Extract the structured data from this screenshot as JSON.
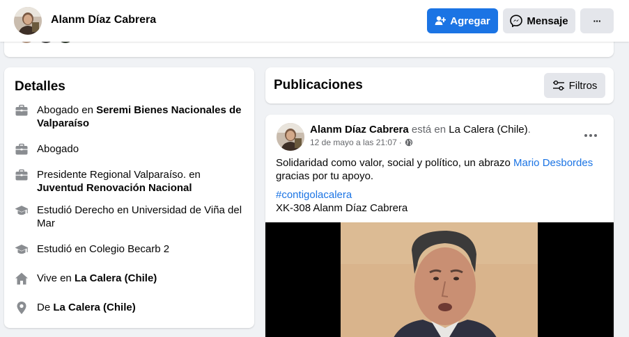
{
  "header": {
    "profile_name": "Alanm Díaz Cabrera",
    "add_label": "Agregar",
    "message_label": "Mensaje",
    "more_label": "···"
  },
  "details": {
    "title": "Detalles",
    "items": [
      {
        "icon": "briefcase-icon",
        "pre": "Abogado en ",
        "strong": "Seremi Bienes Nacionales de Valparaíso"
      },
      {
        "icon": "briefcase-icon",
        "pre": "Abogado",
        "strong": ""
      },
      {
        "icon": "briefcase-icon",
        "pre": "Presidente Regional Valparaíso. en ",
        "strong": "Juventud Renovación Nacional"
      },
      {
        "icon": "graduation-cap-icon",
        "pre": "Estudió Derecho en Universidad de Viña del Mar",
        "strong": ""
      },
      {
        "icon": "graduation-cap-icon",
        "pre": "Estudió en Colegio Becarb 2",
        "strong": ""
      },
      {
        "icon": "home-icon",
        "pre": "Vive en ",
        "strong": "La Calera (Chile)"
      },
      {
        "icon": "location-pin-icon",
        "pre": "De ",
        "strong": "La Calera (Chile)"
      }
    ]
  },
  "publications": {
    "title": "Publicaciones",
    "filters_label": "Filtros"
  },
  "post": {
    "author": "Alanm Díaz Cabrera",
    "status_text": " está en ",
    "location": "La Calera (Chile)",
    "period": ".",
    "timestamp": "12 de mayo a las 21:07",
    "dot": "·",
    "body_line1": "Solidaridad como valor, social y político,  un abrazo ",
    "mention": "Mario Desbordes",
    "body_line2": "gracias por tu apoyo.",
    "hashtag": "#contigolacalera",
    "code_line": "XK-308 Alanm Díaz Cabrera"
  },
  "colors": {
    "primary": "#1b74e4",
    "secondary_button": "#e4e6eb",
    "page_background": "#f0f2f5",
    "secondary_text": "#65676b"
  }
}
